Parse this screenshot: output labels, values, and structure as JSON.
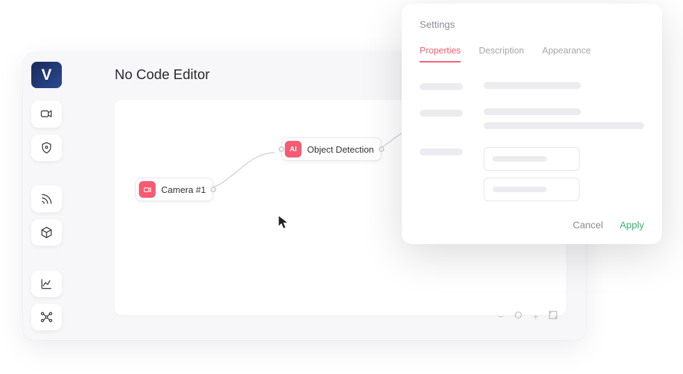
{
  "app": {
    "logo": "V",
    "title": "No Code Editor"
  },
  "nodes": {
    "camera": {
      "icon": "camera",
      "label": "Camera #1"
    },
    "ai": {
      "icon_text": "AI",
      "label": "Object Detection"
    }
  },
  "settings": {
    "title": "Settings",
    "tabs": {
      "properties": "Properties",
      "description": "Description",
      "appearance": "Appearance"
    },
    "actions": {
      "cancel": "Cancel",
      "apply": "Apply"
    }
  },
  "zoom": {
    "minus": "−",
    "plus": "+"
  }
}
